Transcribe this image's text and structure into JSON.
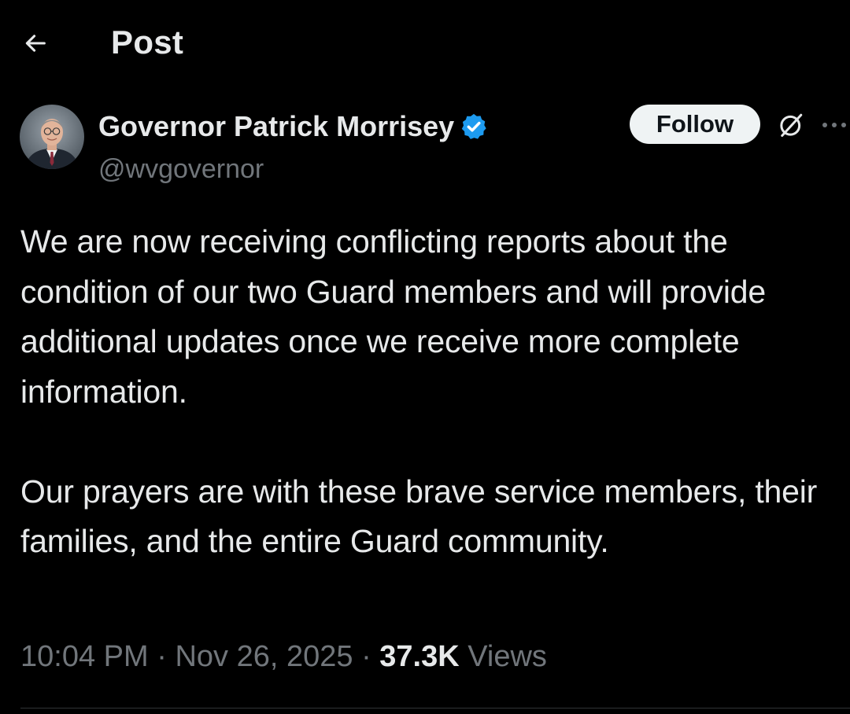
{
  "header": {
    "title": "Post"
  },
  "author": {
    "display_name": "Governor Patrick Morrisey",
    "handle": "@wvgovernor",
    "verified": true
  },
  "actions": {
    "follow_label": "Follow"
  },
  "tweet": {
    "paragraphs": [
      "We are now receiving conflicting reports about the condition of our two Guard members and will provide additional updates once we receive more complete information.",
      "Our prayers are with these brave service members, their families, and the entire Guard community."
    ]
  },
  "meta": {
    "time": "10:04 PM",
    "separator": "·",
    "date": "Nov 26, 2025",
    "views_count": "37.3K",
    "views_label": "Views"
  },
  "icons": {
    "back": "arrow-left-icon",
    "verified": "verified-badge-icon",
    "grok": "grok-icon",
    "more": "more-options-icon"
  },
  "colors": {
    "background": "#000000",
    "text_primary": "#e7e9ea",
    "text_secondary": "#71767b",
    "verified_blue": "#1d9bf0",
    "follow_bg": "#eff3f4",
    "divider": "#2f3336"
  }
}
